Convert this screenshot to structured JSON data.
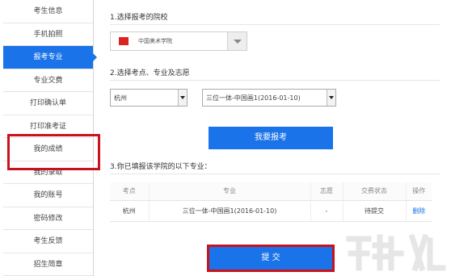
{
  "sidebar": {
    "items": [
      {
        "label": "考生信息"
      },
      {
        "label": "手机拍照"
      },
      {
        "label": "报考专业",
        "active": true
      },
      {
        "label": "专业交费"
      },
      {
        "label": "打印确认单"
      },
      {
        "label": "打印准考证"
      },
      {
        "label": "我的成绩"
      },
      {
        "label": "我的录取"
      },
      {
        "label": "我的账号"
      },
      {
        "label": "密码修改"
      },
      {
        "label": "考生反馈"
      },
      {
        "label": "招生简章"
      }
    ]
  },
  "main": {
    "step1_title": "1.选择报考的院校",
    "school": {
      "selected": "中国美术学院"
    },
    "step2_title": "2.选择考点、专业及志愿",
    "exam_site": {
      "selected": "杭州"
    },
    "major": {
      "selected": "三位一体-中国画1(2016-01-10)"
    },
    "apply_button": "我要报考",
    "step3_title": "3.你已填报该学院的以下专业：",
    "table": {
      "headers": [
        "考点",
        "专业",
        "志愿",
        "交费状态",
        "操作"
      ],
      "rows": [
        {
          "site": "杭州",
          "major": "三位一体-中国画1(2016-01-10)",
          "preference": "-",
          "status": "待提交",
          "action": "删除"
        }
      ]
    },
    "submit_button": "提  交"
  },
  "colors": {
    "accent": "#1a73e8",
    "highlight_box": "#c8121d"
  }
}
